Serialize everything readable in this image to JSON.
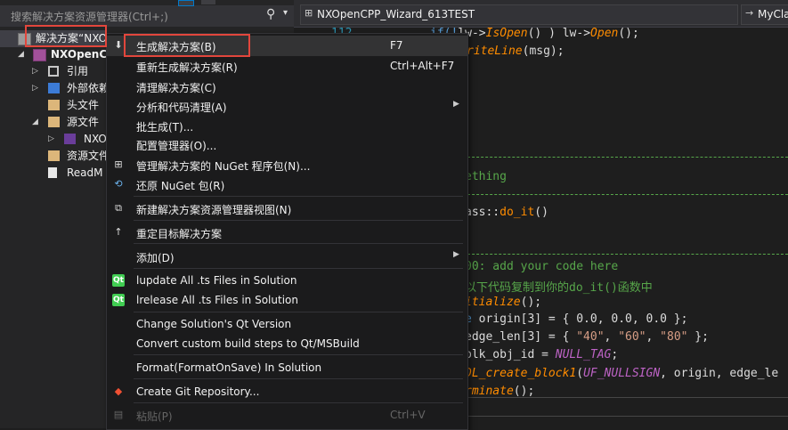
{
  "explorer": {
    "search_placeholder": "搜索解决方案资源管理器(Ctrl+;)",
    "tree": [
      {
        "label": "解决方案“NXO"
      },
      {
        "label": "NXOpenC"
      },
      {
        "label": "引用"
      },
      {
        "label": "外部依赖"
      },
      {
        "label": "头文件"
      },
      {
        "label": "源文件"
      },
      {
        "label": "NXO"
      },
      {
        "label": "资源文件"
      },
      {
        "label": "ReadM"
      }
    ]
  },
  "editor": {
    "file_dropdown": "NXOpenCPP_Wizard_613TEST",
    "class_dropdown": "MyCla",
    "line_number": "112",
    "code_lines": {
      "l1_a": "if(!",
      "l1_b": "lw->",
      "l1_c": "IsOpen",
      "l1_d": "() ) lw->",
      "l1_e": "Open",
      "l1_f": "();",
      "l2_a": "riteLine",
      "l2_b": "(msg);",
      "l3": "ething",
      "l4_a": "ass::",
      "l4_b": "do_it",
      "l4_c": "()",
      "l5": "00: add your code here",
      "l6": "以下代码复制到你的do_it()函数中",
      "l7_a": "itialize",
      "l7_b": "();",
      "l8_a": "e",
      "l8_b": " origin[3] = { 0.0, 0.0, 0.0 };",
      "l9_a": " edge_len[3] = { ",
      "l9_b": "\"40\"",
      "l9_c": ", ",
      "l9_d": "\"60\"",
      "l9_e": ", ",
      "l9_f": "\"80\"",
      "l9_g": " };",
      "l10_a": " blk_obj_id = ",
      "l10_b": "NULL_TAG",
      "l10_c": ";",
      "l11_a": "DL_create_block1",
      "l11_b": "(",
      "l11_c": "UF_NULLSIGN",
      "l11_d": ", origin, edge_le",
      "l12_a": "rminate",
      "l12_b": "();"
    }
  },
  "context_menu": {
    "items": [
      {
        "label": "生成解决方案(B)",
        "shortcut": "F7",
        "icon": "build-icon"
      },
      {
        "label": "重新生成解决方案(R)",
        "shortcut": "Ctrl+Alt+F7"
      },
      {
        "label": "清理解决方案(C)"
      },
      {
        "label": "分析和代码清理(A)"
      },
      {
        "label": "批生成(T)..."
      },
      {
        "label": "配置管理器(O)..."
      },
      {
        "label": "管理解决方案的 NuGet 程序包(N)...",
        "icon": "nuget-icon"
      },
      {
        "label": "还原 NuGet 包(R)",
        "icon": "restore-icon"
      },
      {
        "label": "新建解决方案资源管理器视图(N)",
        "icon": "new-view-icon"
      },
      {
        "label": "重定目标解决方案",
        "icon": "retarget-icon"
      },
      {
        "label": "添加(D)"
      },
      {
        "label": "lupdate All .ts Files in Solution",
        "icon": "qt-icon"
      },
      {
        "label": "lrelease All .ts Files in Solution",
        "icon": "qt-icon"
      },
      {
        "label": "Change Solution's Qt Version"
      },
      {
        "label": "Convert custom build steps to Qt/MSBuild"
      },
      {
        "label": "Format(FormatOnSave) In Solution"
      },
      {
        "label": "Create Git Repository...",
        "icon": "git-icon"
      },
      {
        "label": "粘贴(P)",
        "shortcut": "Ctrl+V",
        "icon": "paste-icon"
      }
    ],
    "qt_badge": "Qt"
  },
  "colors": {
    "highlight_box": "#e2463c",
    "menu_bg": "#1b1b1c",
    "panel_bg": "#252526"
  }
}
